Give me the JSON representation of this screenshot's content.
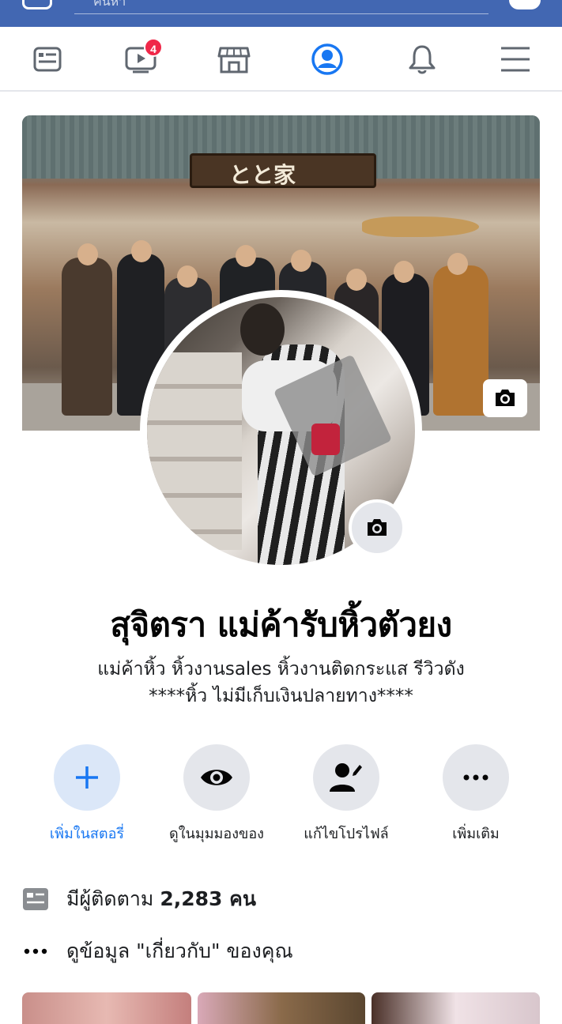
{
  "topbar": {
    "search_placeholder": "ค้นหา"
  },
  "nav": {
    "items": [
      {
        "name": "news-feed",
        "icon": "news-feed-icon"
      },
      {
        "name": "watch",
        "icon": "video-icon",
        "badge": "4"
      },
      {
        "name": "marketplace",
        "icon": "store-icon"
      },
      {
        "name": "profile",
        "icon": "profile-icon",
        "active": true
      },
      {
        "name": "notifications",
        "icon": "bell-icon"
      },
      {
        "name": "menu",
        "icon": "hamburger-icon"
      }
    ],
    "accent": "#1877f2"
  },
  "profile": {
    "name": "สุจิตรา แม่ค้ารับหิ้วตัวยง",
    "bio_line1": "แม่ค้าหิ้ว หิ้วงานsales หิ้วงานติดกระแส รีวิวดัง",
    "bio_line2": "****หิ้ว ไม่มีเก็บเงินปลายทาง****",
    "cover_sign_text": "とと家"
  },
  "actions": [
    {
      "label": "เพิ่มในสตอรี่",
      "icon": "plus-icon"
    },
    {
      "label": "ดูในมุมมองของ",
      "icon": "eye-icon"
    },
    {
      "label": "แก้ไขโปรไฟล์",
      "icon": "edit-profile-icon"
    },
    {
      "label": "เพิ่มเติม",
      "icon": "more-icon"
    }
  ],
  "info": {
    "followers_prefix": "มีผู้ติดตาม",
    "followers_count": "2,283 คน",
    "about_text": "ดูข้อมูล \"เกี่ยวกับ\" ของคุณ"
  },
  "colors": {
    "facebook_blue": "#4267b2",
    "badge_red": "#f02849",
    "button_gray": "#e4e6eb"
  }
}
